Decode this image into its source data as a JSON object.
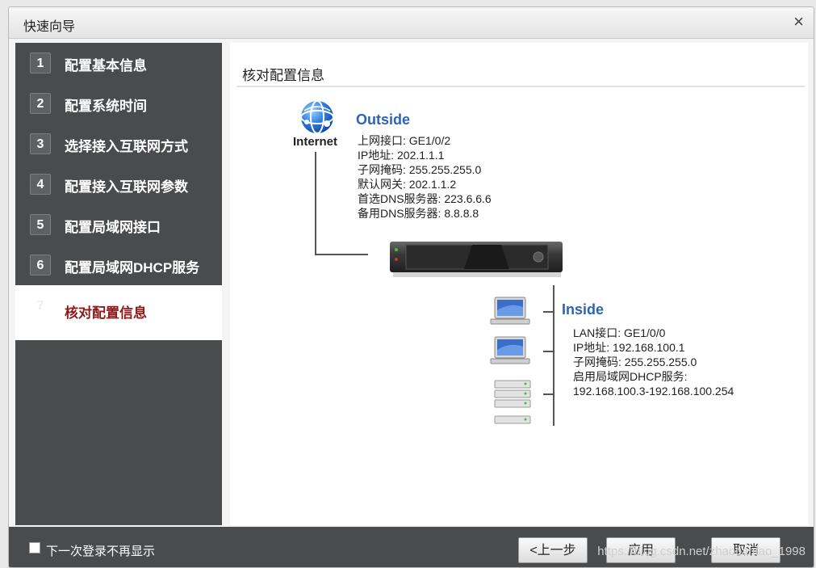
{
  "window": {
    "title": "快速向导",
    "close_icon": "×"
  },
  "sidebar": {
    "steps": [
      {
        "num": "1",
        "label": "配置基本信息"
      },
      {
        "num": "2",
        "label": "配置系统时间"
      },
      {
        "num": "3",
        "label": "选择接入互联网方式"
      },
      {
        "num": "4",
        "label": "配置接入互联网参数"
      },
      {
        "num": "5",
        "label": "配置局域网接口"
      },
      {
        "num": "6",
        "label": "配置局域网DHCP服务"
      },
      {
        "num": "7",
        "label": "核对配置信息"
      }
    ],
    "active_step": 7
  },
  "content": {
    "title": "核对配置信息",
    "internet_label": "Internet",
    "outside": {
      "heading": "Outside",
      "lines": [
        "上网接口: GE1/0/2",
        "IP地址: 202.1.1.1",
        "子网掩码: 255.255.255.0",
        "默认网关: 202.1.1.2",
        "首选DNS服务器: 223.6.6.6",
        "备用DNS服务器: 8.8.8.8"
      ]
    },
    "inside": {
      "heading": "Inside",
      "lines": [
        "LAN接口: GE1/0/0",
        "IP地址: 192.168.100.1",
        "子网掩码: 255.255.255.0",
        "启用局域网DHCP服务:",
        "192.168.100.3-192.168.100.254"
      ]
    }
  },
  "footer": {
    "checkbox_label": "下一次登录不再显示",
    "checkbox_checked": false,
    "prev_label": "<上一步",
    "apply_label": "应用",
    "cancel_label": "取消",
    "watermark": "https://blog.csdn.net/zhaotiantao_1998"
  },
  "colors": {
    "sidebar_bg": "#4a4b4c",
    "active_label": "#8b1a1a",
    "heading_blue": "#2e63b3"
  }
}
